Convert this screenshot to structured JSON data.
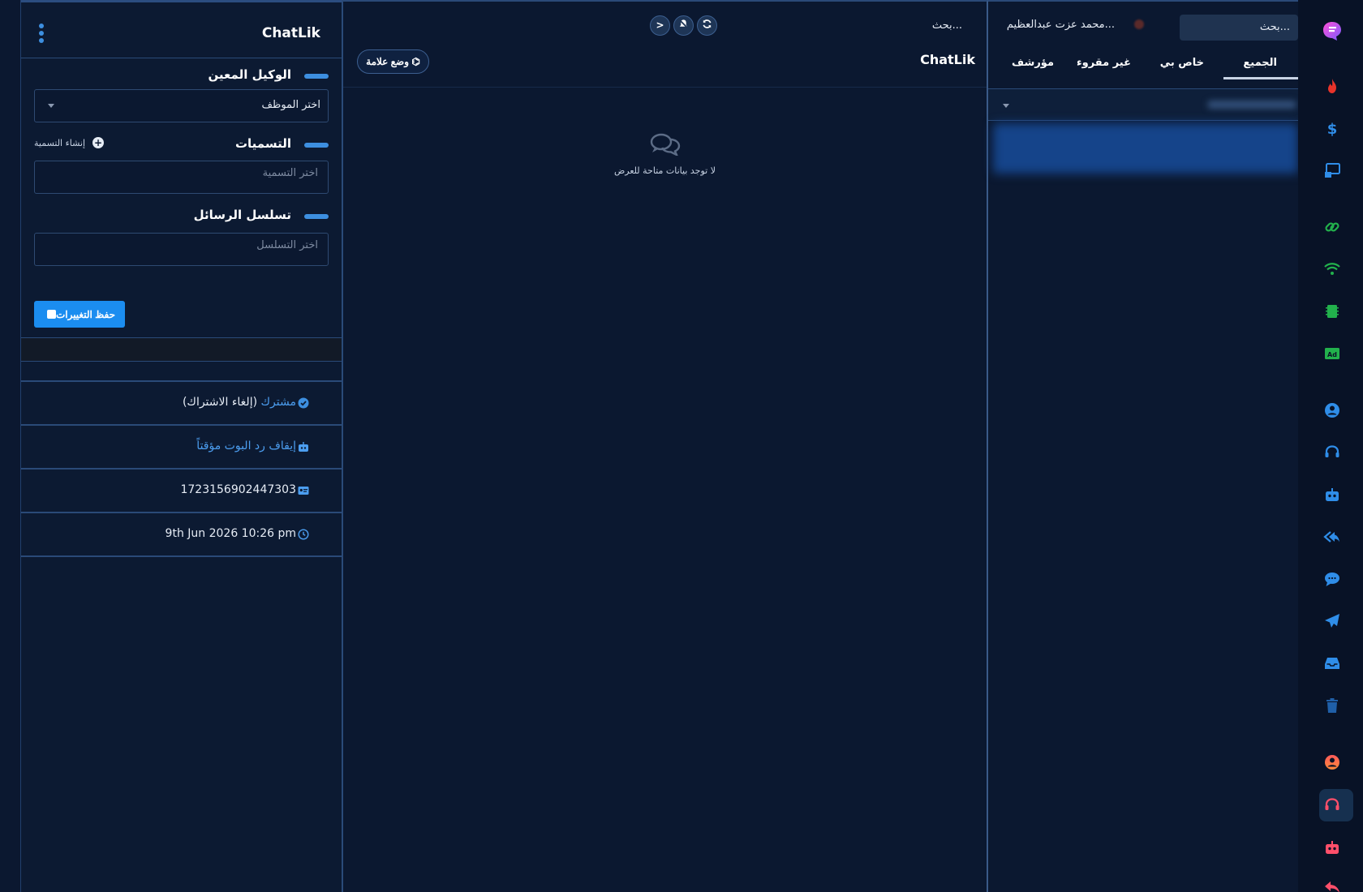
{
  "details": {
    "title": "ChatLik",
    "assigned_agent": {
      "title": "الوكيل المعين",
      "value": "اختر الموظف"
    },
    "labels": {
      "title": "التسميات",
      "create_label": "إنشاء التسمية",
      "placeholder": "اختر التسمية"
    },
    "sequence": {
      "title": "تسلسل الرسائل",
      "placeholder": "اختر التسلسل"
    },
    "save_label": "حفظ التغييرات",
    "subscribed_text": "مشترك",
    "unsubscribe_text": "(إلغاء الاشتراك)",
    "pause_bot_text": "إيقاف رد البوت مؤقتاً",
    "user_id": "1723156902447303",
    "date": "9th Jun 2026 10:26 pm"
  },
  "chat": {
    "search_label": "بحث...",
    "title": "ChatLik",
    "mark_button": "وضع علامة",
    "empty_text": "لا توجد بيانات متاحة للعرض"
  },
  "list": {
    "search_placeholder": "بحث...",
    "user_name": "محمد عزت عبدالعظيم...",
    "tabs": [
      "الجميع",
      "خاص بي",
      "غير مقروء",
      "مؤرشف"
    ]
  },
  "colors": {
    "accent": "#1b8df0",
    "background": "#0b1830",
    "panel": "#0c1a32"
  },
  "rail_icons": [
    "app-logo-icon",
    "fire-icon",
    "dollar-icon",
    "cast-icon",
    "link-icon",
    "wifi-icon",
    "chip-icon",
    "ad-icon",
    "user-circle-icon",
    "headset-icon",
    "robot-icon",
    "reply-all-icon",
    "comment-icon",
    "paper-plane-icon",
    "inbox-icon",
    "trash-icon",
    "profile-icon",
    "support-headset-icon",
    "bot-icon",
    "reply-icon"
  ]
}
